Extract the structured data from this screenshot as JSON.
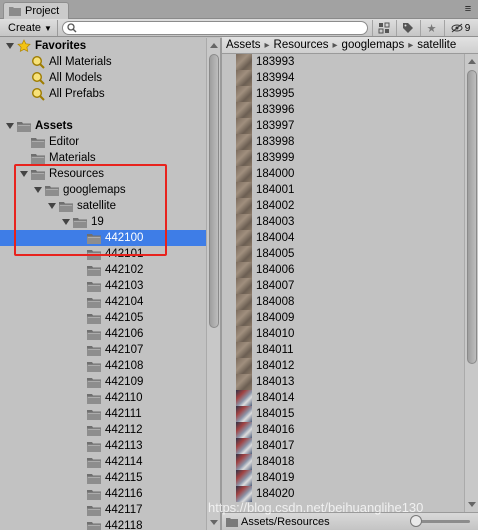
{
  "tab": {
    "title": "Project"
  },
  "toolbar": {
    "create_label": "Create",
    "search_value": "",
    "hidden_count": "9"
  },
  "tree": [
    {
      "label": "Favorites",
      "kind": "favorites-header",
      "indent": 0,
      "arrow": true,
      "bold": true
    },
    {
      "label": "All Materials",
      "kind": "search",
      "indent": 1
    },
    {
      "label": "All Models",
      "kind": "search",
      "indent": 1
    },
    {
      "label": "All Prefabs",
      "kind": "search",
      "indent": 1
    },
    {
      "label": "",
      "kind": "spacer",
      "indent": 0
    },
    {
      "label": "Assets",
      "kind": "folder",
      "indent": 0,
      "arrow": true,
      "bold": true
    },
    {
      "label": "Editor",
      "kind": "folder",
      "indent": 1
    },
    {
      "label": "Materials",
      "kind": "folder",
      "indent": 1
    },
    {
      "label": "Resources",
      "kind": "folder",
      "indent": 1,
      "arrow": true
    },
    {
      "label": "googlemaps",
      "kind": "folder",
      "indent": 2,
      "arrow": true
    },
    {
      "label": "satellite",
      "kind": "folder",
      "indent": 3,
      "arrow": true
    },
    {
      "label": "19",
      "kind": "folder",
      "indent": 4,
      "arrow": true
    },
    {
      "label": "442100",
      "kind": "folder",
      "indent": 5,
      "selected": true
    },
    {
      "label": "442101",
      "kind": "folder",
      "indent": 5
    },
    {
      "label": "442102",
      "kind": "folder",
      "indent": 5
    },
    {
      "label": "442103",
      "kind": "folder",
      "indent": 5
    },
    {
      "label": "442104",
      "kind": "folder",
      "indent": 5
    },
    {
      "label": "442105",
      "kind": "folder",
      "indent": 5
    },
    {
      "label": "442106",
      "kind": "folder",
      "indent": 5
    },
    {
      "label": "442107",
      "kind": "folder",
      "indent": 5
    },
    {
      "label": "442108",
      "kind": "folder",
      "indent": 5
    },
    {
      "label": "442109",
      "kind": "folder",
      "indent": 5
    },
    {
      "label": "442110",
      "kind": "folder",
      "indent": 5
    },
    {
      "label": "442111",
      "kind": "folder",
      "indent": 5
    },
    {
      "label": "442112",
      "kind": "folder",
      "indent": 5
    },
    {
      "label": "442113",
      "kind": "folder",
      "indent": 5
    },
    {
      "label": "442114",
      "kind": "folder",
      "indent": 5
    },
    {
      "label": "442115",
      "kind": "folder",
      "indent": 5
    },
    {
      "label": "442116",
      "kind": "folder",
      "indent": 5
    },
    {
      "label": "442117",
      "kind": "folder",
      "indent": 5
    },
    {
      "label": "442118",
      "kind": "folder",
      "indent": 5
    }
  ],
  "breadcrumb": [
    "Assets",
    "Resources",
    "googlemaps",
    "satellite"
  ],
  "files": [
    "183993",
    "183994",
    "183995",
    "183996",
    "183997",
    "183998",
    "183999",
    "184000",
    "184001",
    "184002",
    "184003",
    "184004",
    "184005",
    "184006",
    "184007",
    "184008",
    "184009",
    "184010",
    "184011",
    "184012",
    "184013",
    "184014",
    "184015",
    "184016",
    "184017",
    "184018",
    "184019",
    "184020"
  ],
  "status": {
    "path": "Assets/Resources"
  },
  "watermark": "https://blog.csdn.net/beihuanglihe130",
  "colors": {
    "selection": "#3e7de7",
    "highlight_box": "#e8231d",
    "panel_bg": "#c2c2c2"
  },
  "icons": {
    "tab": "lock-folder-icon",
    "search": "magnifier-icon",
    "favorites": "star-icon",
    "folder": "folder-icon",
    "eye": "eye-hidden-icon"
  }
}
